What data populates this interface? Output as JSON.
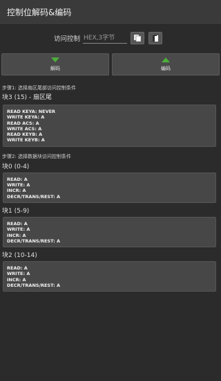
{
  "app": {
    "title": "控制位解码&编码"
  },
  "access": {
    "label": "访问控制",
    "placeholder": "HEX,3字节",
    "value": ""
  },
  "buttons": {
    "decode_label": "解码",
    "encode_label": "编码"
  },
  "step1": {
    "text": "步骤1: 选择扇区尾部访问控制条件"
  },
  "sector_trailer": {
    "title": "块3 (15) - 扇区尾",
    "lines": [
      "READ KEYA: NEVER",
      "WRITE KEYA: A",
      "READ ACS: A",
      "WRITE ACS: A",
      "READ KEYB: A",
      "WRITE KEYB: A"
    ]
  },
  "step2": {
    "text": "步骤2: 选择数据块访问控制条件"
  },
  "blocks": [
    {
      "title": "块0 (0-4)",
      "lines": [
        "READ: A",
        "WRITE: A",
        "INCR: A",
        "DECR/TRANS/REST: A"
      ]
    },
    {
      "title": "块1 (5-9)",
      "lines": [
        "READ: A",
        "WRITE: A",
        "INCR: A",
        "DECR/TRANS/REST: A"
      ]
    },
    {
      "title": "块2 (10-14)",
      "lines": [
        "READ: A",
        "WRITE: A",
        "INCR: A",
        "DECR/TRANS/REST: A"
      ]
    }
  ],
  "icons": {
    "paste": "paste-icon",
    "copy": "copy-icon",
    "decode": "arrow-down-icon",
    "encode": "arrow-up-icon"
  },
  "colors": {
    "accent": "#4caf3a",
    "background": "#2b2b2b",
    "panel": "#474747"
  }
}
